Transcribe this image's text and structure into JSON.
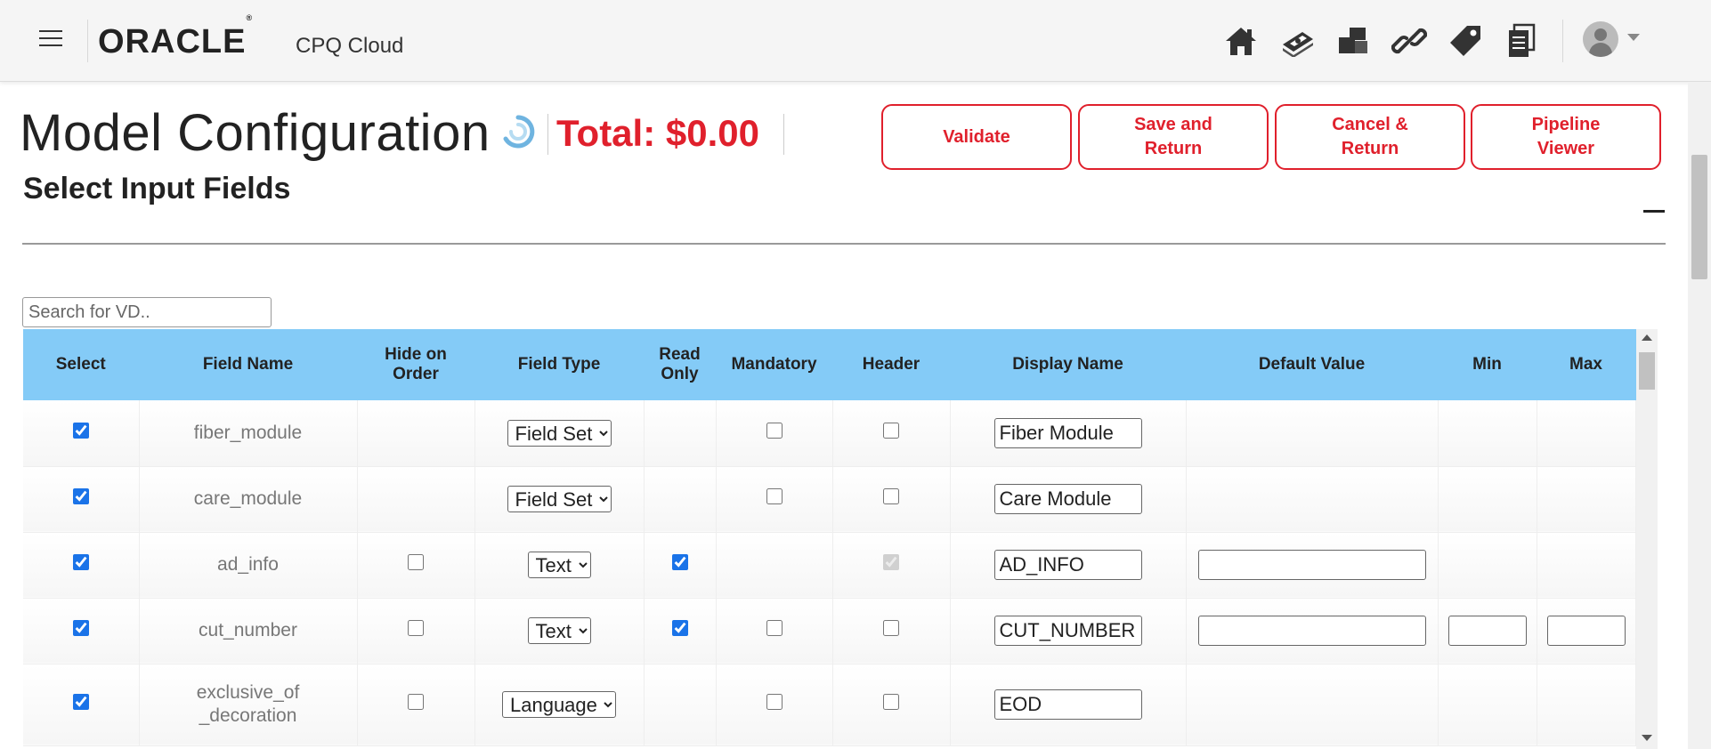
{
  "app": {
    "brand": "ORACLE",
    "registered": "®",
    "product": "CPQ Cloud",
    "nav_icons": [
      "home-icon",
      "money-icon",
      "blocks-icon",
      "link-icon",
      "tag-icon",
      "documents-icon"
    ]
  },
  "header": {
    "title": "Model Configuration",
    "total": "Total: $0.00",
    "buttons": {
      "validate": "Validate",
      "save_return": "Save and\nReturn",
      "cancel_return": "Cancel &\nReturn",
      "pipeline_viewer": "Pipeline\nViewer"
    }
  },
  "section": {
    "title": "Select Input Fields",
    "collapse_symbol": "—"
  },
  "search": {
    "placeholder": "Search for VD.."
  },
  "table": {
    "columns": [
      "Select",
      "Field Name",
      "Hide on Order",
      "Field Type",
      "Read Only",
      "Mandatory",
      "Header",
      "Display Name",
      "Default Value",
      "Min",
      "Max"
    ],
    "rows": [
      {
        "field_name": "fiber_module",
        "field_type": "Field Set",
        "display_name": "Fiber Module"
      },
      {
        "field_name": "care_module",
        "field_type": "Field Set",
        "display_name": "Care Module"
      },
      {
        "field_name": "ad_info",
        "field_type": "Text",
        "display_name": "AD_INFO"
      },
      {
        "field_name": "cut_number",
        "field_type": "Text",
        "display_name": "CUT_NUMBER"
      },
      {
        "field_name": "exclusive_of\n_decoration",
        "field_type": "Language",
        "display_name": "EOD"
      }
    ]
  },
  "colors": {
    "accent_red": "#e0202c",
    "table_header": "#84cbf7"
  }
}
